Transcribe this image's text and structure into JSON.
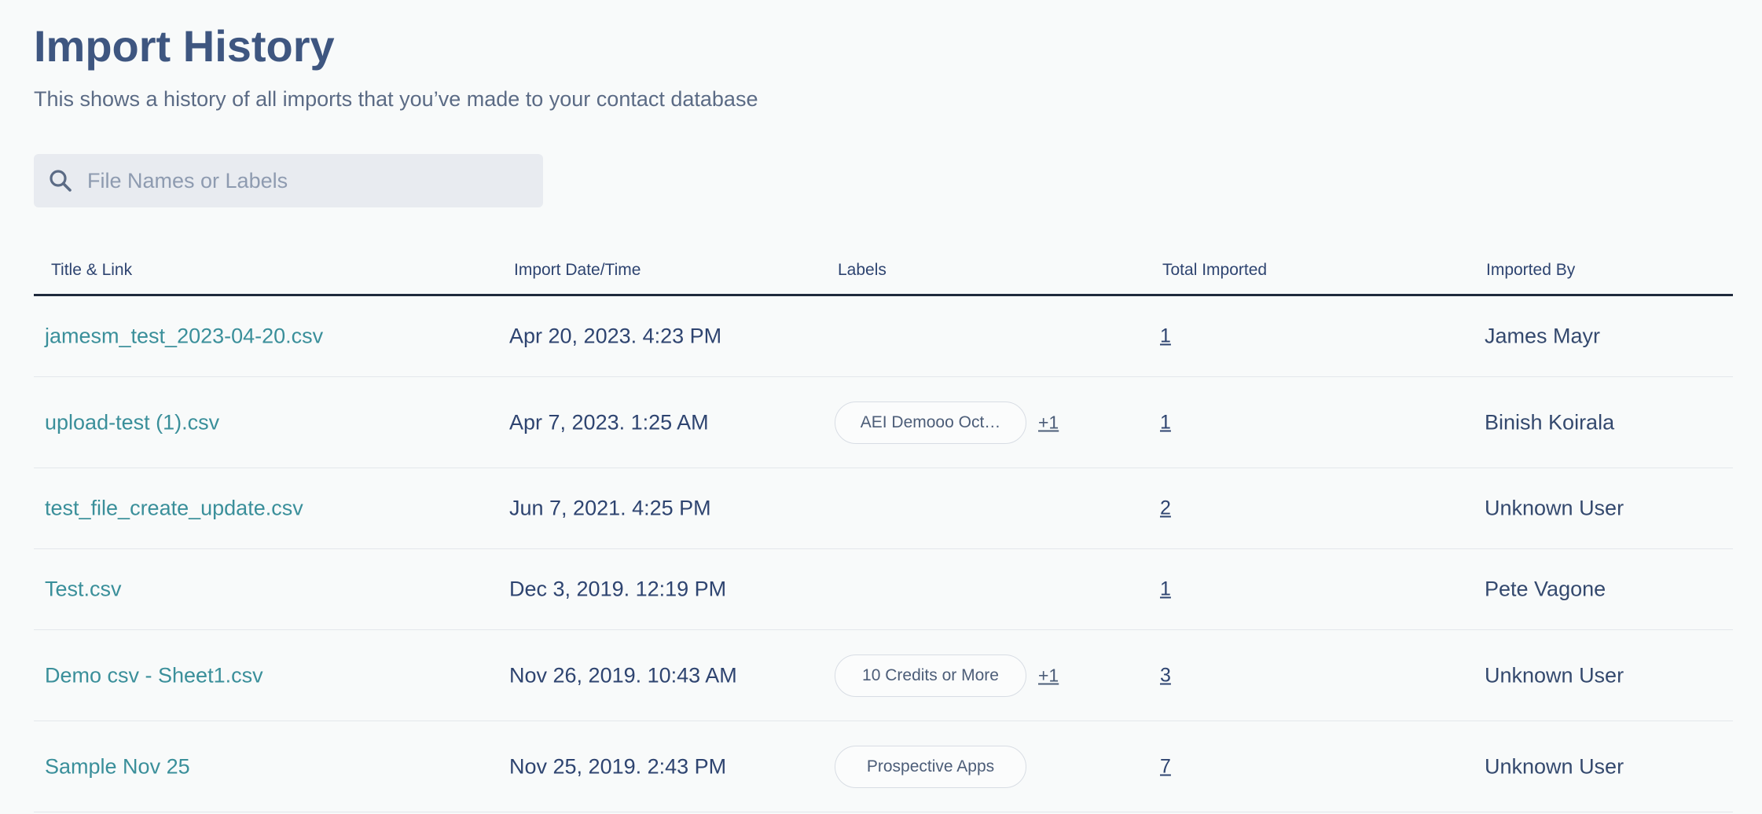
{
  "page": {
    "title": "Import History",
    "subtitle": "This shows a history of all imports that you’ve made to your contact database"
  },
  "search": {
    "placeholder": "File Names or Labels",
    "value": ""
  },
  "table": {
    "columns": [
      "Title & Link",
      "Import Date/Time",
      "Labels",
      "Total Imported",
      "Imported By"
    ],
    "rows": [
      {
        "title": "jamesm_test_2023-04-20.csv",
        "date": "Apr 20, 2023. 4:23 PM",
        "label": "",
        "more": "",
        "total": "1",
        "by": "James Mayr"
      },
      {
        "title": "upload-test (1).csv",
        "date": "Apr 7, 2023. 1:25 AM",
        "label": "AEI Demooo Oct…",
        "more": "+1",
        "total": "1",
        "by": "Binish Koirala"
      },
      {
        "title": "test_file_create_update.csv",
        "date": "Jun 7, 2021. 4:25 PM",
        "label": "",
        "more": "",
        "total": "2",
        "by": "Unknown User"
      },
      {
        "title": "Test.csv",
        "date": "Dec 3, 2019. 12:19 PM",
        "label": "",
        "more": "",
        "total": "1",
        "by": "Pete Vagone"
      },
      {
        "title": "Demo csv - Sheet1.csv",
        "date": "Nov 26, 2019. 10:43 AM",
        "label": "10 Credits or More",
        "more": "+1",
        "total": "3",
        "by": "Unknown User"
      },
      {
        "title": "Sample Nov 25",
        "date": "Nov 25, 2019. 2:43 PM",
        "label": "Prospective Apps",
        "more": "",
        "total": "7",
        "by": "Unknown User"
      }
    ]
  },
  "colors": {
    "link": "#3a8f9a",
    "title": "#3e5680",
    "text": "#2e4470",
    "background": "#f8fafa",
    "search_bg": "#e8ebf0"
  },
  "icons": {
    "search": "search-icon"
  }
}
